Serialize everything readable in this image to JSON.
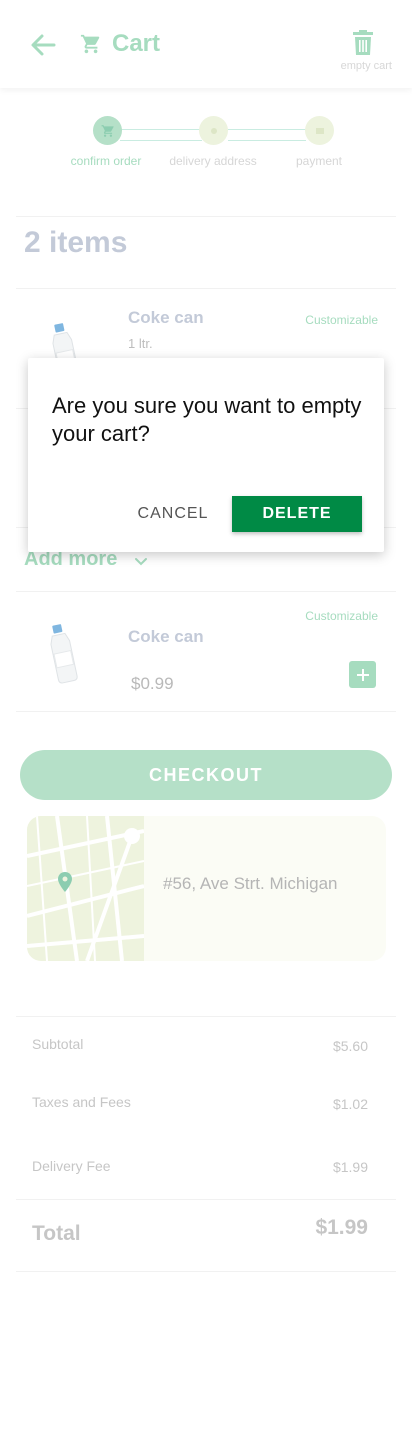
{
  "header": {
    "title": "Cart",
    "empty_cart_label": "empty cart",
    "icons": [
      "back-arrow-icon",
      "cart-icon",
      "trash-icon"
    ]
  },
  "stepper": {
    "steps": [
      {
        "label": "confirm order",
        "active": true
      },
      {
        "label": "delivery address",
        "active": false
      },
      {
        "label": "payment",
        "active": false
      }
    ]
  },
  "cart": {
    "items_count": "2 items",
    "products": [
      {
        "name": "Coke can",
        "size": "1 ltr.",
        "customizable": "Customizable"
      },
      {
        "name": "Coke can",
        "customizable": "Customizable",
        "price": "$0.99"
      }
    ],
    "add_more": "Add more"
  },
  "checkout_label": "CHECKOUT",
  "address": "#56, Ave Strt. Michigan",
  "summary": {
    "subtotal_label": "Subtotal",
    "subtotal": "$5.60",
    "taxes_label": "Taxes and Fees",
    "taxes": "$1.02",
    "delivery_label": "Delivery Fee",
    "delivery": "$1.99",
    "total_label": "Total",
    "total": "$1.99"
  },
  "dialog": {
    "message": "Are you sure you want to empty your cart?",
    "cancel_label": "CANCEL",
    "delete_label": "DELETE"
  },
  "colors": {
    "accent": "#a6dcbf",
    "delete": "#008a45"
  }
}
